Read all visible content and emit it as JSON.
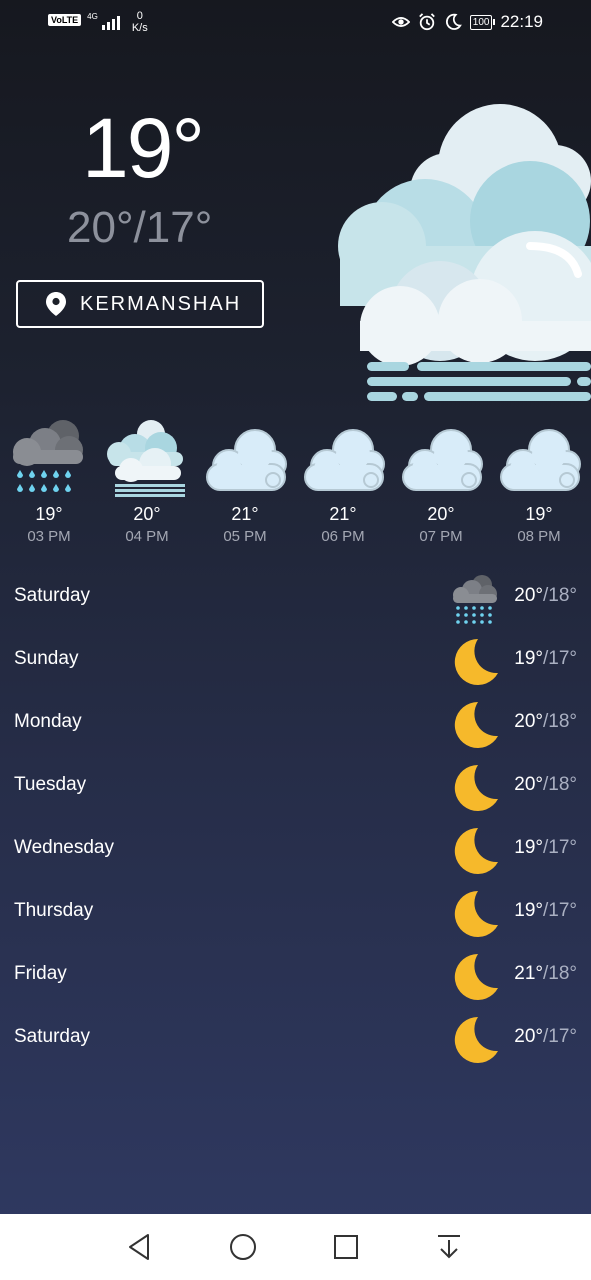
{
  "status_bar": {
    "volte": "VoLTE",
    "network": "4G",
    "speed_value": "0",
    "speed_unit": "K/s",
    "battery": "100",
    "time": "22:19",
    "icons": [
      "eye-icon",
      "alarm-icon",
      "moon-icon"
    ]
  },
  "current": {
    "temperature": "19°",
    "high_low": "20°/17°",
    "location": "KERMANSHAH",
    "condition_icon": "cloudy-fog-icon"
  },
  "hourly": [
    {
      "temp": "19°",
      "time": "03 PM",
      "icon": "rain-cloud-icon"
    },
    {
      "temp": "20°",
      "time": "04 PM",
      "icon": "cloudy-fog-icon"
    },
    {
      "temp": "21°",
      "time": "05 PM",
      "icon": "cloud-icon"
    },
    {
      "temp": "21°",
      "time": "06 PM",
      "icon": "cloud-icon"
    },
    {
      "temp": "20°",
      "time": "07 PM",
      "icon": "cloud-icon"
    },
    {
      "temp": "19°",
      "time": "08 PM",
      "icon": "cloud-icon"
    }
  ],
  "daily": [
    {
      "day": "Saturday",
      "high": "20°",
      "low": "18°",
      "icon": "rain-cloud-icon"
    },
    {
      "day": "Sunday",
      "high": "19°",
      "low": "17°",
      "icon": "moon-icon"
    },
    {
      "day": "Monday",
      "high": "20°",
      "low": "18°",
      "icon": "moon-icon"
    },
    {
      "day": "Tuesday",
      "high": "20°",
      "low": "18°",
      "icon": "moon-icon"
    },
    {
      "day": "Wednesday",
      "high": "19°",
      "low": "17°",
      "icon": "moon-icon"
    },
    {
      "day": "Thursday",
      "high": "19°",
      "low": "17°",
      "icon": "moon-icon"
    },
    {
      "day": "Friday",
      "high": "21°",
      "low": "18°",
      "icon": "moon-icon"
    },
    {
      "day": "Saturday",
      "high": "20°",
      "low": "17°",
      "icon": "moon-icon"
    }
  ],
  "daily_separator": "/",
  "nav": [
    "back-icon",
    "home-icon",
    "recents-icon",
    "notification-pull-icon"
  ],
  "colors": {
    "moon": "#f6b92b",
    "cloud_light": "#e6f2f8",
    "cloud_teal": "#a9d6e0",
    "rain": "#6fd3ef",
    "cloud_dark": "#7c7f86"
  }
}
